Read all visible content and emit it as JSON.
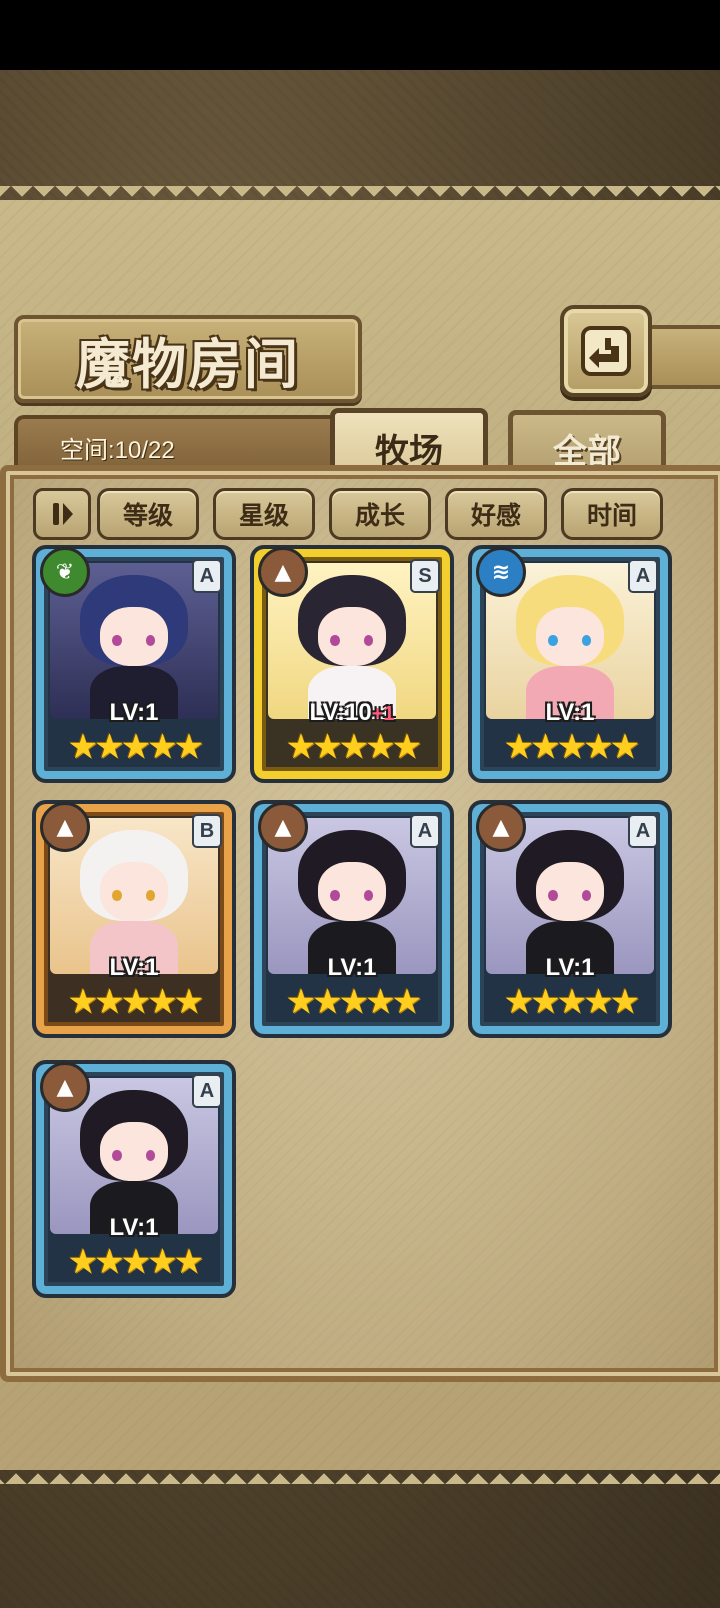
{
  "page": {
    "title": "魔物房间",
    "space_label": "空间:10/22"
  },
  "tabs": [
    {
      "label": "牧场",
      "active": true
    },
    {
      "label": "全部",
      "active": false
    }
  ],
  "filters": [
    "等级",
    "星级",
    "成长",
    "好感",
    "时间"
  ],
  "icons": {
    "back": "back-arrow-icon",
    "toggle": "pause-toggle-icon",
    "star": "star-icon"
  },
  "cards": [
    {
      "level": "LV:1",
      "bonus": "",
      "rank": "A",
      "element": "nature",
      "stars": 5,
      "frame": "blue",
      "star_text": "★★★★★"
    },
    {
      "level": "LV:10",
      "bonus": "+1",
      "rank": "S",
      "element": "earth",
      "stars": 5,
      "frame": "gold",
      "star_text": "★★★★★"
    },
    {
      "level": "LV:1",
      "bonus": "",
      "rank": "A",
      "element": "water",
      "stars": 5,
      "frame": "blue",
      "star_text": "★★★★★"
    },
    {
      "level": "LV:1",
      "bonus": "",
      "rank": "B",
      "element": "earth",
      "stars": 5,
      "frame": "orange",
      "star_text": "★★★★★"
    },
    {
      "level": "LV:1",
      "bonus": "",
      "rank": "A",
      "element": "earth",
      "stars": 5,
      "frame": "blue",
      "star_text": "★★★★★"
    },
    {
      "level": "LV:1",
      "bonus": "",
      "rank": "A",
      "element": "earth",
      "stars": 5,
      "frame": "blue",
      "star_text": "★★★★★"
    },
    {
      "level": "LV:1",
      "bonus": "",
      "rank": "A",
      "element": "earth",
      "stars": 5,
      "frame": "blue",
      "star_text": "★★★★★"
    }
  ],
  "colors": {
    "nature": "#3f8a2e",
    "earth": "#8a5a3a",
    "water": "#2c7fc2"
  }
}
